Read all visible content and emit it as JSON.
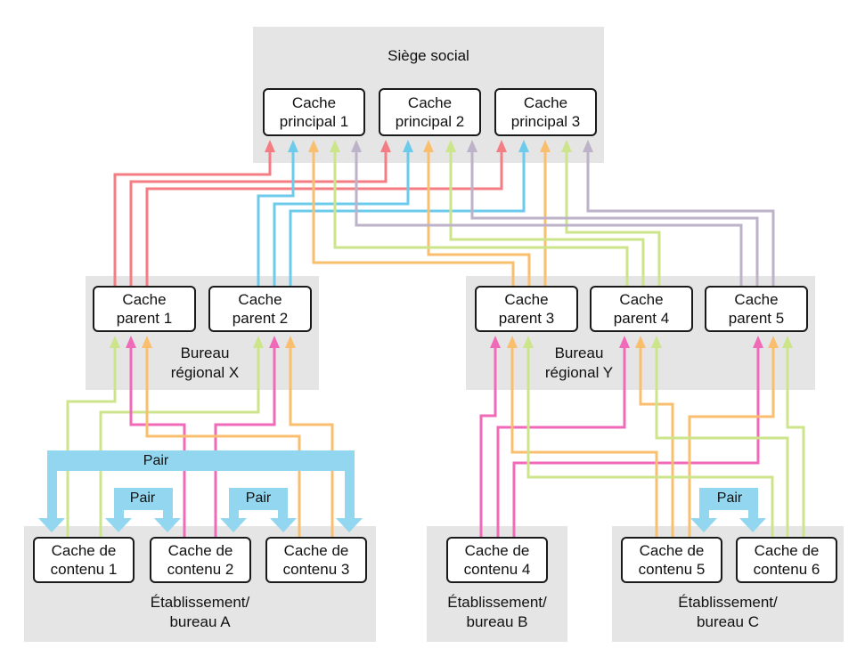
{
  "colors": {
    "zone_bg": "#e5e5e5",
    "red": "#f47d84",
    "blue": "#6ccbeb",
    "orange": "#f9bf6f",
    "green": "#cce58a",
    "purple": "#bdb2c8",
    "pink": "#f06ab9",
    "pair": "#93d6f0"
  },
  "headquarters": {
    "label": "Siège social",
    "caches": [
      {
        "line1": "Cache",
        "line2": "principal 1"
      },
      {
        "line1": "Cache",
        "line2": "principal 2"
      },
      {
        "line1": "Cache",
        "line2": "principal 3"
      }
    ]
  },
  "regional_x": {
    "label_line1": "Bureau",
    "label_line2": "régional X",
    "caches": [
      {
        "line1": "Cache",
        "line2": "parent 1"
      },
      {
        "line1": "Cache",
        "line2": "parent 2"
      }
    ]
  },
  "regional_y": {
    "label_line1": "Bureau",
    "label_line2": "régional Y",
    "caches": [
      {
        "line1": "Cache",
        "line2": "parent 3"
      },
      {
        "line1": "Cache",
        "line2": "parent 4"
      },
      {
        "line1": "Cache",
        "line2": "parent 5"
      }
    ]
  },
  "site_a": {
    "label_line1": "Établissement/",
    "label_line2": "bureau A",
    "caches": [
      {
        "line1": "Cache de",
        "line2": "contenu 1"
      },
      {
        "line1": "Cache de",
        "line2": "contenu 2"
      },
      {
        "line1": "Cache de",
        "line2": "contenu 3"
      }
    ]
  },
  "site_b": {
    "label_line1": "Établissement/",
    "label_line2": "bureau B",
    "caches": [
      {
        "line1": "Cache de",
        "line2": "contenu 4"
      }
    ]
  },
  "site_c": {
    "label_line1": "Établissement/",
    "label_line2": "bureau C",
    "caches": [
      {
        "line1": "Cache de",
        "line2": "contenu 5"
      },
      {
        "line1": "Cache de",
        "line2": "contenu 6"
      }
    ]
  },
  "peer_links": [
    {
      "label": "Pair",
      "between": [
        "Cache de contenu 1",
        "Cache de contenu 3"
      ]
    },
    {
      "label": "Pair",
      "between": [
        "Cache de contenu 1",
        "Cache de contenu 2"
      ]
    },
    {
      "label": "Pair",
      "between": [
        "Cache de contenu 2",
        "Cache de contenu 3"
      ]
    },
    {
      "label": "Pair",
      "between": [
        "Cache de contenu 5",
        "Cache de contenu 6"
      ]
    }
  ],
  "connections": [
    {
      "from": "Cache parent 1",
      "to": "Cache principal 1",
      "color": "red"
    },
    {
      "from": "Cache parent 1",
      "to": "Cache principal 2",
      "color": "red"
    },
    {
      "from": "Cache parent 1",
      "to": "Cache principal 3",
      "color": "red"
    },
    {
      "from": "Cache parent 2",
      "to": "Cache principal 1",
      "color": "blue"
    },
    {
      "from": "Cache parent 2",
      "to": "Cache principal 2",
      "color": "blue"
    },
    {
      "from": "Cache parent 2",
      "to": "Cache principal 3",
      "color": "blue"
    },
    {
      "from": "Cache parent 3",
      "to": "Cache principal 1",
      "color": "orange"
    },
    {
      "from": "Cache parent 3",
      "to": "Cache principal 2",
      "color": "orange"
    },
    {
      "from": "Cache parent 3",
      "to": "Cache principal 3",
      "color": "orange"
    },
    {
      "from": "Cache parent 4",
      "to": "Cache principal 1",
      "color": "green"
    },
    {
      "from": "Cache parent 4",
      "to": "Cache principal 2",
      "color": "green"
    },
    {
      "from": "Cache parent 4",
      "to": "Cache principal 3",
      "color": "green"
    },
    {
      "from": "Cache parent 5",
      "to": "Cache principal 1",
      "color": "purple"
    },
    {
      "from": "Cache parent 5",
      "to": "Cache principal 2",
      "color": "purple"
    },
    {
      "from": "Cache parent 5",
      "to": "Cache principal 3",
      "color": "purple"
    },
    {
      "from": "Cache de contenu 1",
      "to": "Cache parent 1",
      "color": "green"
    },
    {
      "from": "Cache de contenu 1",
      "to": "Cache parent 2",
      "color": "green"
    },
    {
      "from": "Cache de contenu 2",
      "to": "Cache parent 1",
      "color": "pink"
    },
    {
      "from": "Cache de contenu 2",
      "to": "Cache parent 2",
      "color": "pink"
    },
    {
      "from": "Cache de contenu 3",
      "to": "Cache parent 1",
      "color": "orange"
    },
    {
      "from": "Cache de contenu 3",
      "to": "Cache parent 2",
      "color": "orange"
    },
    {
      "from": "Cache de contenu 4",
      "to": "Cache parent 3",
      "color": "pink"
    },
    {
      "from": "Cache de contenu 4",
      "to": "Cache parent 4",
      "color": "pink"
    },
    {
      "from": "Cache de contenu 4",
      "to": "Cache parent 5",
      "color": "pink"
    },
    {
      "from": "Cache de contenu 5",
      "to": "Cache parent 3",
      "color": "orange"
    },
    {
      "from": "Cache de contenu 5",
      "to": "Cache parent 4",
      "color": "orange"
    },
    {
      "from": "Cache de contenu 5",
      "to": "Cache parent 5",
      "color": "orange"
    },
    {
      "from": "Cache de contenu 6",
      "to": "Cache parent 3",
      "color": "green"
    },
    {
      "from": "Cache de contenu 6",
      "to": "Cache parent 4",
      "color": "green"
    },
    {
      "from": "Cache de contenu 6",
      "to": "Cache parent 5",
      "color": "green"
    }
  ]
}
